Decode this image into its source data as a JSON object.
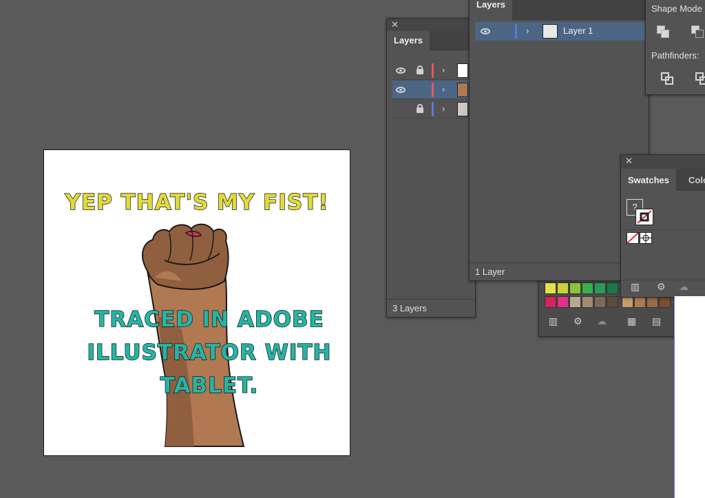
{
  "artboard": {
    "title": "YEP THAT'S MY FIST!",
    "body_lines": [
      "TRACED IN ADOBE",
      "ILLUSTRATOR WITH",
      "TABLET."
    ]
  },
  "layers_panel_back": {
    "tab_label": "Layers",
    "footer": "3 Layers",
    "rows": [
      {
        "visible": true,
        "locked": true,
        "color": "#e05a5a"
      },
      {
        "visible": true,
        "locked": false,
        "color": "#e05a5a"
      },
      {
        "visible": false,
        "locked": true,
        "color": "#5a7ae0"
      }
    ]
  },
  "layers_panel_front": {
    "tab_label": "Layers",
    "row_label": "Layer 1",
    "footer": "1 Layer"
  },
  "pathfinder_panel": {
    "shape_modes_label": "Shape Mode",
    "pathfinders_label": "Pathfinders:"
  },
  "swatches_panel": {
    "tab_label": "Swatches",
    "tab2_label": "Colo",
    "none_swatch_label": "?"
  },
  "colors": {
    "panel_bg": "#535353",
    "selection": "#4d6585",
    "title_yellow": "#e2d93b",
    "body_teal": "#26b4a6"
  },
  "icons": [
    "close-icon",
    "eye-icon",
    "lock-icon",
    "chevron-right-icon",
    "library-icon",
    "cloud-icon",
    "grid-icon",
    "trash-icon"
  ]
}
